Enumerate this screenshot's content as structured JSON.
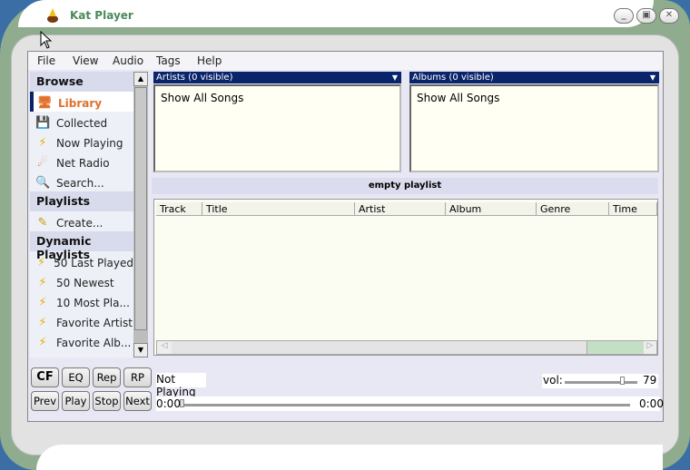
{
  "window": {
    "title": "Kat Player",
    "minimize": "_",
    "maximize": "▣",
    "close": "✕"
  },
  "menu": [
    "File",
    "View",
    "Audio",
    "Tags",
    "Help"
  ],
  "sidebar": {
    "browse": "Browse",
    "browse_items": [
      {
        "label": "Library",
        "icon": "library-icon"
      },
      {
        "label": "Collected",
        "icon": "save-icon"
      },
      {
        "label": "Now Playing",
        "icon": "lightning-icon"
      },
      {
        "label": "Net Radio",
        "icon": "radio-icon"
      },
      {
        "label": "Search...",
        "icon": "search-icon"
      }
    ],
    "playlists": "Playlists",
    "playlist_items": [
      {
        "label": "Create...",
        "icon": "pencil-icon"
      }
    ],
    "dynamic": "Dynamic Playlists",
    "dynamic_items": [
      {
        "label": "50 Last Played"
      },
      {
        "label": "50 Newest"
      },
      {
        "label": "10 Most Pla..."
      },
      {
        "label": "Favorite Artist"
      },
      {
        "label": "Favorite Alb..."
      }
    ]
  },
  "artists": {
    "header": "Artists (0 visible)",
    "items": [
      "Show All Songs"
    ]
  },
  "albums": {
    "header": "Albums (0 visible)",
    "items": [
      "Show All Songs"
    ]
  },
  "playlist": {
    "title": "empty playlist",
    "columns": [
      "Track",
      "Title",
      "Artist",
      "Album",
      "Genre",
      "Time"
    ]
  },
  "controls": {
    "buttons_top": [
      "CF",
      "EQ",
      "Rep",
      "RP"
    ],
    "buttons_bottom": [
      "Prev",
      "Play",
      "Stop",
      "Next"
    ],
    "status": "Not Playing",
    "vol_label": "vol:",
    "volume": "79",
    "time_start": "0:00",
    "time_end": "0:00",
    "progress": 0
  },
  "colors": {
    "frame": "#8fac8f",
    "header": "#0a246a",
    "accent": "#e0702a"
  }
}
